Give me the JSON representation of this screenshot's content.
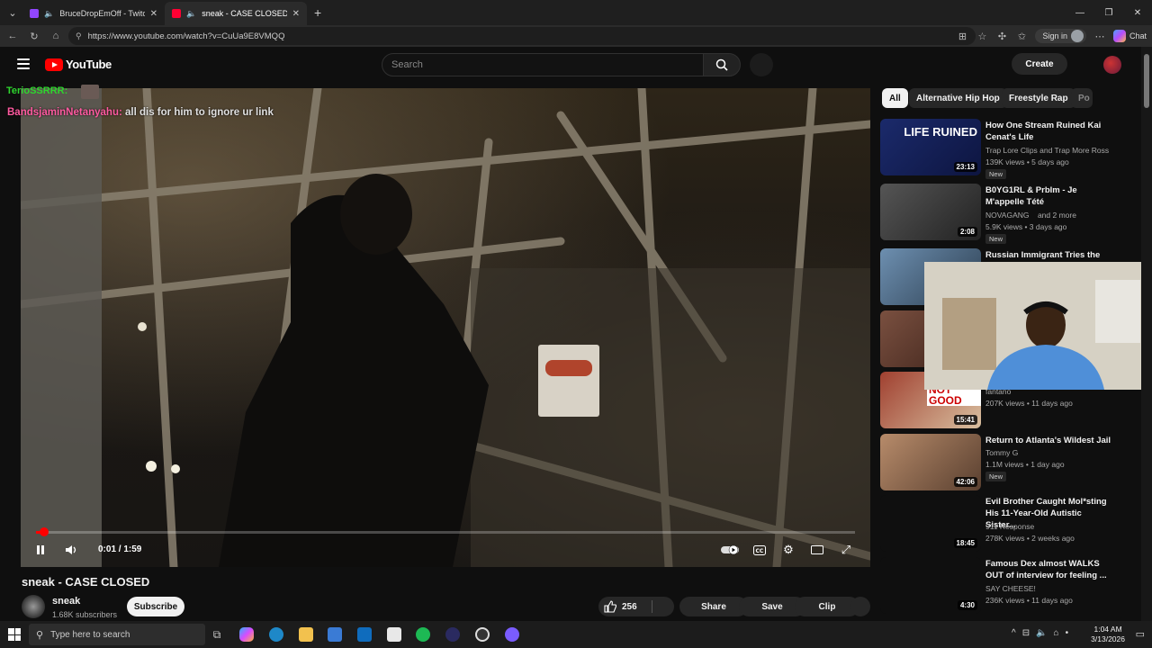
{
  "browser": {
    "tabs": [
      {
        "title": "BruceDropEmOff - Twitch",
        "active": false,
        "favicon_color": "#9146ff"
      },
      {
        "title": "sneak - CASE CLOSED - YouTube",
        "active": true,
        "favicon_color": "#ff0033"
      }
    ],
    "url": "https://www.youtube.com/watch?v=CuUa9E8VMQQ",
    "signin_label": "Sign in",
    "chat_label": "Chat"
  },
  "youtube": {
    "logo_text": "YouTube",
    "search_placeholder": "Search",
    "create_label": "Create"
  },
  "overlay_chat": {
    "line1": "TerioSSRRR:",
    "line2_name": "BandsjaminNetanyahu:",
    "line2_msg": " all dis for him to ignore ur link"
  },
  "player": {
    "time": "0:01 / 1:59",
    "progress": 0.01,
    "state": "playing"
  },
  "video": {
    "title": "sneak - CASE CLOSED",
    "channel": "sneak",
    "subscribers": "1.68K subscribers",
    "subscribe_label": "Subscribe",
    "likes": "256",
    "share_label": "Share",
    "save_label": "Save",
    "clip_label": "Clip"
  },
  "chips": [
    "All",
    "Alternative Hip Hop",
    "Freestyle Rap",
    "Po"
  ],
  "recommendations": [
    {
      "title": "How One Stream Ruined Kai Cenat's Life",
      "channel": "Trap Lore Clips and Trap More Ross",
      "meta": "139K views • 5 days ago",
      "duration": "23:13",
      "badge": "New",
      "thumb_color": "#1b2a6b",
      "thumb_text": "LIFE RUINED"
    },
    {
      "title": "B0YG1RL & Prblm - Je M'appelle Tété",
      "channel": "NOVAGANG",
      "channel_extra": "and 2 more",
      "meta": "5.9K views • 3 days ago",
      "duration": "2:08",
      "badge": "New",
      "thumb_color": "#3a3a3a"
    },
    {
      "title": "Russian Immigrant Tries the",
      "channel": "",
      "meta": "",
      "duration": "",
      "badge": "",
      "thumb_color": "#4a6a8a"
    },
    {
      "title": "",
      "channel": "",
      "meta": "",
      "duration": "",
      "badge": "",
      "thumb_color": "#6a4a3a"
    },
    {
      "title": "",
      "channel": "fantano",
      "meta": "207K views • 11 days ago",
      "duration": "15:41",
      "badge": "",
      "thumb_color": "#8a3a2a",
      "thumb_text": "NOT GOOD"
    },
    {
      "title": "Return to Atlanta's Wildest Jail",
      "channel": "Tommy G",
      "meta": "1.1M views • 1 day ago",
      "duration": "42:06",
      "badge": "New",
      "thumb_color": "#6a5a4a"
    },
    {
      "title": "Evil Brother Caught Mol*sting His 11-Year-Old Autistic Sister...",
      "channel": "911 Response",
      "meta": "278K views • 2 weeks ago",
      "duration": "18:45",
      "badge": "",
      "thumb_color": "#0f0f0f"
    },
    {
      "title": "Famous Dex almost WALKS OUT of interview for feeling ...",
      "channel": "SAY CHEESE!",
      "meta": "236K views • 11 days ago",
      "duration": "4:30",
      "badge": "",
      "thumb_color": "#0f0f0f"
    }
  ],
  "taskbar": {
    "search_placeholder": "Type here to search",
    "time": "1:04 AM",
    "date": "3/13/2026"
  },
  "colors": {
    "accent": "#ff0000",
    "bg": "#0f0f0f",
    "twitch": "#9146ff"
  }
}
